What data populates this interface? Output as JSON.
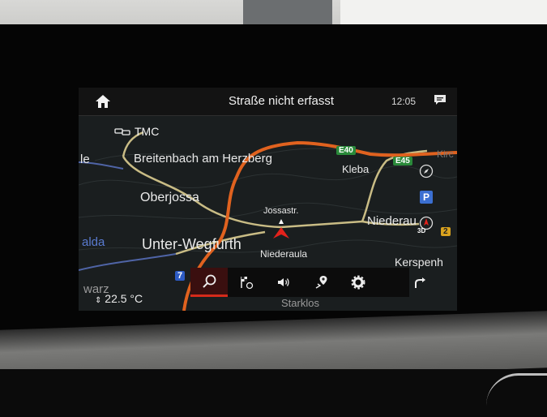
{
  "header": {
    "title": "Straße nicht erfasst",
    "time": "12:05"
  },
  "traffic": {
    "label": "TMC"
  },
  "map": {
    "places": {
      "le": "le",
      "breitenbach": "Breitenbach am Herzberg",
      "kleba": "Kleba",
      "kirc": "Kirc",
      "oberjossa": "Oberjossa",
      "jossastr": "Jossastr.",
      "niederaula_right": "Niederau",
      "alda": "alda",
      "unter_wegfurth": "Unter-Wegfurth",
      "niederaula": "Niederaula",
      "kerspenh": "Kerspenh",
      "warz": "warz",
      "starklos": "Starklos"
    },
    "road_signs": {
      "e40": "E40",
      "e45": "E45",
      "a7": "7",
      "route2": "2"
    },
    "colors": {
      "motorway": "#e0621f",
      "main_road": "#cfc28a",
      "river": "#5a6fb0",
      "position_marker": "#e3221b",
      "motorway_sign": "#2a8a3a"
    }
  },
  "side_buttons": {
    "compass": "compass-icon",
    "parking": "P",
    "view_mode": "3D"
  },
  "toolbar": {
    "items": [
      "search-icon",
      "destination-flag-icon",
      "volume-icon",
      "route-pin-icon",
      "settings-gear-icon",
      "auto-turn-icon"
    ],
    "active": "search-icon"
  },
  "status": {
    "temperature": "22.5 °C"
  }
}
